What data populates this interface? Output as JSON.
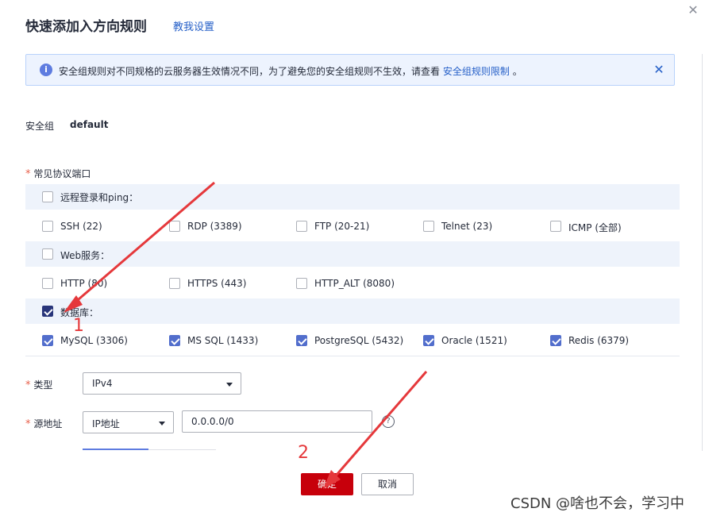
{
  "dialog": {
    "title": "快速添加入方向规则",
    "help_link": "教我设置"
  },
  "alert": {
    "text": "安全组规则对不同规格的云服务器生效情况不同，为了避免您的安全组规则不生效，请查看",
    "link": "安全组规则限制",
    "suffix": "。"
  },
  "security_group": {
    "label": "安全组",
    "value": "default"
  },
  "ports": {
    "label": "常见协议端口",
    "required_mark": "*",
    "groups": [
      {
        "label": "远程登录和ping：",
        "checked": false,
        "items": [
          {
            "label": "SSH (22)",
            "checked": false
          },
          {
            "label": "RDP (3389)",
            "checked": false
          },
          {
            "label": "FTP (20-21)",
            "checked": false
          },
          {
            "label": "Telnet (23)",
            "checked": false
          },
          {
            "label": "ICMP (全部)",
            "checked": false
          }
        ]
      },
      {
        "label": "Web服务：",
        "checked": false,
        "items": [
          {
            "label": "HTTP (80)",
            "checked": false
          },
          {
            "label": "HTTPS (443)",
            "checked": false
          },
          {
            "label": "HTTP_ALT (8080)",
            "checked": false
          }
        ]
      },
      {
        "label": "数据库：",
        "checked": true,
        "items": [
          {
            "label": "MySQL (3306)",
            "checked": true
          },
          {
            "label": "MS SQL (1433)",
            "checked": true
          },
          {
            "label": "PostgreSQL (5432)",
            "checked": true
          },
          {
            "label": "Oracle (1521)",
            "checked": true
          },
          {
            "label": "Redis (6379)",
            "checked": true
          }
        ]
      }
    ]
  },
  "type_field": {
    "label": "类型",
    "required_mark": "*",
    "value": "IPv4"
  },
  "source_field": {
    "label": "源地址",
    "required_mark": "*",
    "select_value": "IP地址",
    "input_value": "0.0.0.0/0",
    "help_icon": "?"
  },
  "buttons": {
    "ok": "确定",
    "cancel": "取消"
  },
  "annotations": {
    "step1": "1",
    "step2": "2",
    "arrow_color": "#e5383b"
  },
  "watermark": "CSDN @啥也不会，学习中",
  "colors": {
    "primary": "#c7000b",
    "link": "#2660c8",
    "checkbox": "#526ecc",
    "alert_bg": "#edf3fe"
  }
}
